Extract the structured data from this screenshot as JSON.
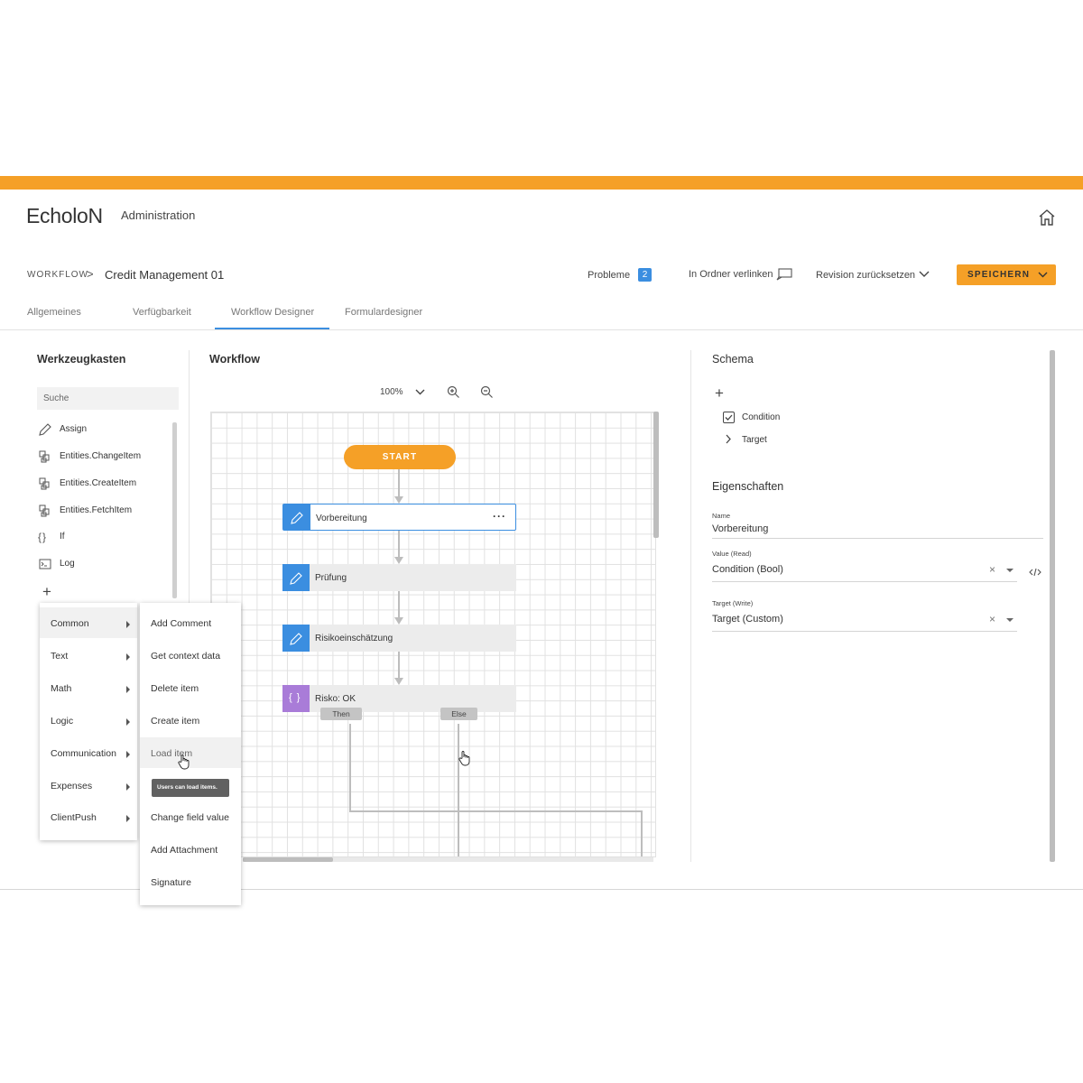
{
  "header": {
    "logo": "EcholoN",
    "subtitle": "Administration"
  },
  "breadcrumb": {
    "root": "WORKFLOW",
    "separator": ">",
    "current": "Credit Management 01"
  },
  "actions": {
    "problems_label": "Probleme",
    "problems_count": "2",
    "link_folder": "In Ordner verlinken",
    "revision": "Revision zurücksetzen",
    "save": "SPEICHERN"
  },
  "tabs": [
    {
      "label": "Allgemeines"
    },
    {
      "label": "Verfügbarkeit"
    },
    {
      "label": "Workflow Designer",
      "active": true
    },
    {
      "label": "Formulardesigner"
    }
  ],
  "toolbox": {
    "title": "Werkzeugkasten",
    "search_placeholder": "Suche",
    "items": [
      {
        "label": "Assign",
        "icon": "pencil-icon"
      },
      {
        "label": "Entities.ChangeItem",
        "icon": "entity-icon"
      },
      {
        "label": "Entities.CreateItem",
        "icon": "entity-icon"
      },
      {
        "label": "Entities.FetchItem",
        "icon": "entity-icon"
      },
      {
        "label": "If",
        "icon": "braces-icon"
      },
      {
        "label": "Log",
        "icon": "terminal-icon"
      }
    ],
    "add": "+"
  },
  "category_menu": [
    {
      "label": "Common"
    },
    {
      "label": "Text"
    },
    {
      "label": "Math"
    },
    {
      "label": "Logic"
    },
    {
      "label": "Communication"
    },
    {
      "label": "Expenses"
    },
    {
      "label": "ClientPush"
    }
  ],
  "submenu": [
    {
      "label": "Add Comment"
    },
    {
      "label": "Get context data"
    },
    {
      "label": "Delete item"
    },
    {
      "label": "Create item"
    },
    {
      "label": "Load item"
    },
    {
      "label": "Change field value"
    },
    {
      "label": "Add Attachment"
    },
    {
      "label": "Signature"
    }
  ],
  "tooltip": "Users can load items.",
  "workflow": {
    "title": "Workflow",
    "zoom": "100%",
    "start": "START",
    "nodes": [
      {
        "label": "Vorbereitung",
        "more": "···"
      },
      {
        "label": "Prüfung"
      },
      {
        "label": "Risikoeinschätzung"
      },
      {
        "label": "Risko: OK"
      }
    ],
    "branch_then": "Then",
    "branch_else": "Else"
  },
  "schema": {
    "title": "Schema",
    "add": "+",
    "items": [
      {
        "label": "Condition"
      },
      {
        "label": "Target"
      }
    ]
  },
  "properties": {
    "title": "Eigenschaften",
    "name_caption": "Name",
    "name_value": "Vorbereitung",
    "value_caption": "Value (Read)",
    "value_value": "Condition (Bool)",
    "target_caption": "Target (Write)",
    "target_value": "Target (Custom)",
    "clear": "×"
  },
  "colors": {
    "accent": "#f5a027",
    "blue": "#3b8ee0",
    "purple": "#a97cd8"
  }
}
